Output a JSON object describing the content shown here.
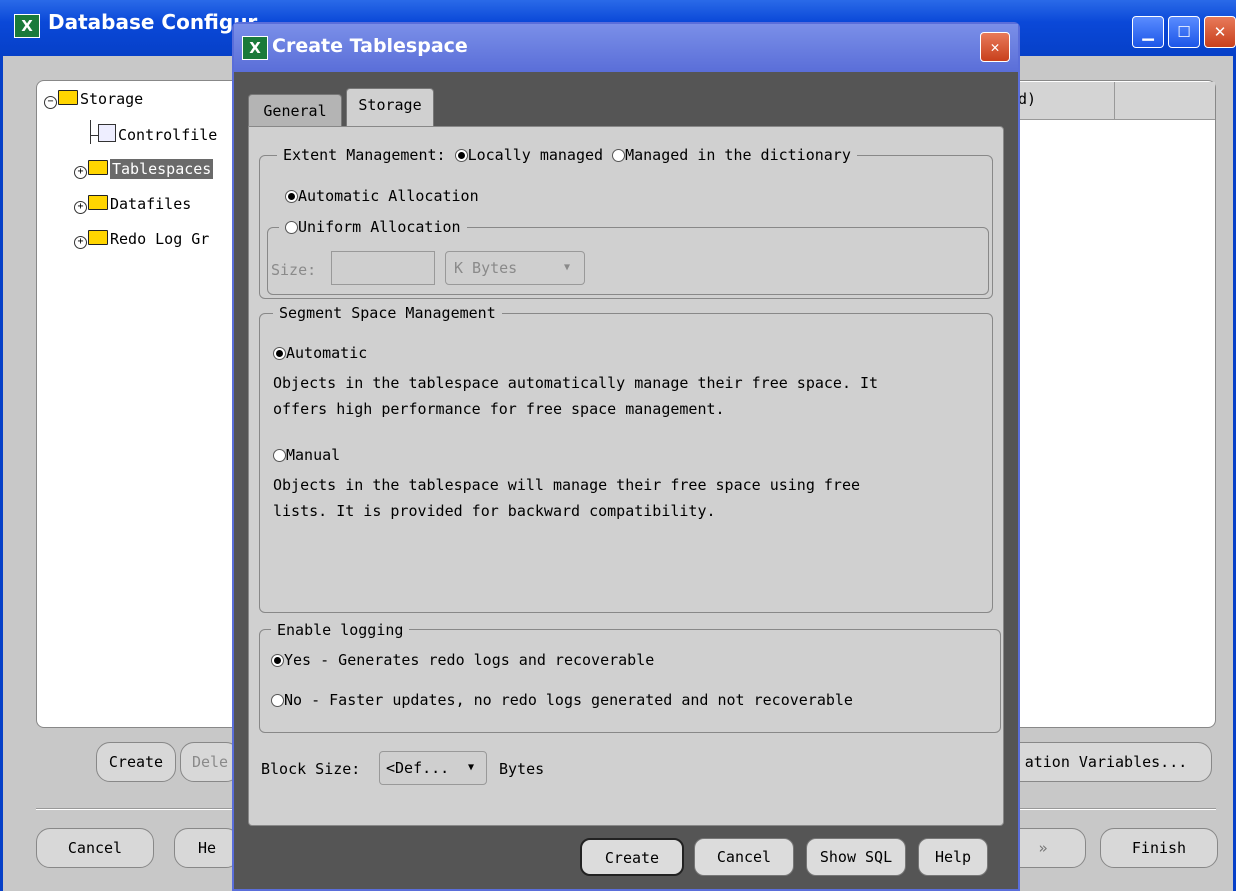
{
  "bg_window": {
    "title": "Database Configur",
    "app_icon": "X",
    "tree": {
      "root": "Storage",
      "items": [
        "Controlfile",
        "Tablespaces",
        "Datafiles",
        "Redo Log Gr"
      ]
    },
    "table_header_fragment": "d)",
    "buttons": {
      "create": "Create",
      "delete": "Dele",
      "variables": "ation Variables...",
      "cancel": "Cancel",
      "help": "He",
      "next": "»",
      "finish": "Finish"
    }
  },
  "dialog": {
    "title": "Create Tablespace",
    "app_icon": "X",
    "tabs": [
      "General",
      "Storage"
    ],
    "active_tab": "Storage",
    "extent": {
      "legend_label": "Extent Management:",
      "locally_managed": "Locally managed",
      "dictionary_managed": "Managed in the dictionary",
      "automatic_allocation": "Automatic Allocation",
      "uniform_allocation": "Uniform Allocation",
      "size_label": "Size:",
      "size_value": "",
      "unit": "K Bytes"
    },
    "segment": {
      "legend": "Segment Space Management",
      "automatic": "Automatic",
      "automatic_desc_1": "Objects in the tablespace automatically manage their free space. It",
      "automatic_desc_2": "offers high performance for free space management.",
      "manual": "Manual",
      "manual_desc_1": "Objects in the tablespace will manage their free space using free",
      "manual_desc_2": "lists. It is provided for backward compatibility."
    },
    "logging": {
      "legend": "Enable logging",
      "yes": "Yes - Generates redo logs and recoverable",
      "no": "No - Faster updates, no redo logs generated and not recoverable"
    },
    "block_size": {
      "label": "Block Size:",
      "value": "<Def...",
      "unit": "Bytes"
    },
    "buttons": {
      "create": "Create",
      "cancel": "Cancel",
      "show_sql": "Show SQL",
      "help": "Help"
    }
  }
}
